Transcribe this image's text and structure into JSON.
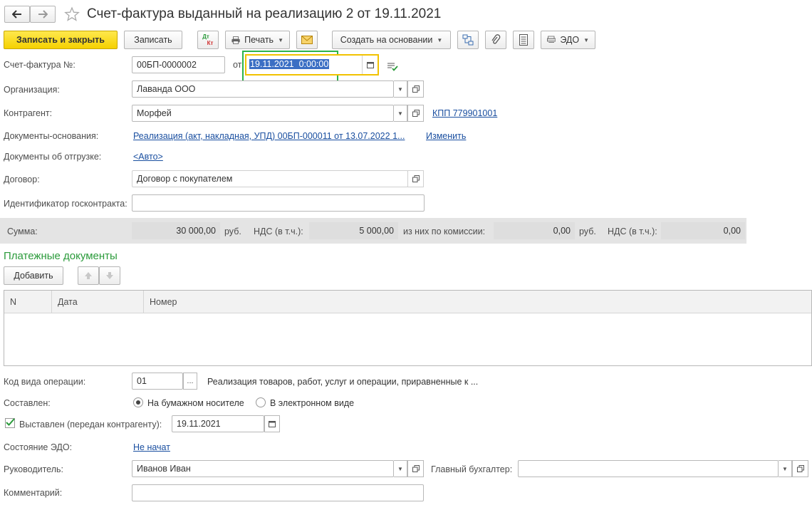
{
  "header": {
    "title": "Счет-фактура выданный на реализацию 2 от 19.11.2021"
  },
  "toolbar": {
    "save_close": "Записать и закрыть",
    "save": "Записать",
    "dtkt_top": "Дт",
    "dtkt_bottom": "Кт",
    "print": "Печать",
    "create_based": "Создать на основании",
    "edo": "ЭДО"
  },
  "form": {
    "invoice_label": "Счет-фактура №:",
    "invoice_number": "00БП-0000002",
    "from_label": "от",
    "invoice_date": "19.11.2021  0:00:00",
    "org_label": "Организация:",
    "org_value": "Лаванда ООО",
    "counterparty_label": "Контрагент:",
    "counterparty_value": "Морфей",
    "kpp_link": "КПП 779901001",
    "base_docs_label": "Документы-основания:",
    "base_docs_link": "Реализация (акт, накладная, УПД) 00БП-000011 от 13.07.2022 1...",
    "change_link": "Изменить",
    "shipment_docs_label": "Документы об отгрузке:",
    "shipment_docs_link": "<Авто>",
    "contract_label": "Договор:",
    "contract_value": "Договор с покупателем",
    "gov_id_label": "Идентификатор госконтракта:",
    "gov_id_value": ""
  },
  "sum": {
    "label": "Сумма:",
    "amount": "30 000,00",
    "currency1": "руб.",
    "vat_label1": "НДС (в т.ч.):",
    "vat_amount": "5 000,00",
    "commission_label": "из них по комиссии:",
    "commission_amount": "0,00",
    "currency2": "руб.",
    "vat_label2": "НДС (в т.ч.):",
    "vat_commission": "0,00"
  },
  "payments": {
    "title": "Платежные документы",
    "add": "Добавить",
    "columns": [
      "N",
      "Дата",
      "Номер"
    ]
  },
  "bottom": {
    "op_code_label": "Код вида операции:",
    "op_code_value": "01",
    "op_code_btn": "...",
    "op_code_desc": "Реализация товаров, работ, услуг и операции, приравненные к ...",
    "composed_label": "Составлен:",
    "paper_option": "На бумажном носителе",
    "electronic_option": "В электронном виде",
    "issued_label": "Выставлен (передан контрагенту):",
    "issued_date": "19.11.2021",
    "edo_state_label": "Состояние ЭДО:",
    "edo_state_link": "Не начат",
    "head_label": "Руководитель:",
    "head_value": "Иванов Иван",
    "chief_acc_label": "Главный бухгалтер:",
    "chief_acc_value": "",
    "comment_label": "Комментарий:",
    "comment_value": ""
  },
  "colors": {
    "primary_button": "#f5d100",
    "link": "#1a4fa0",
    "section_title": "#2a9a3a",
    "highlight_green": "#2db34a",
    "highlight_yellow": "#f2c200",
    "selection": "#3b6fc4"
  }
}
